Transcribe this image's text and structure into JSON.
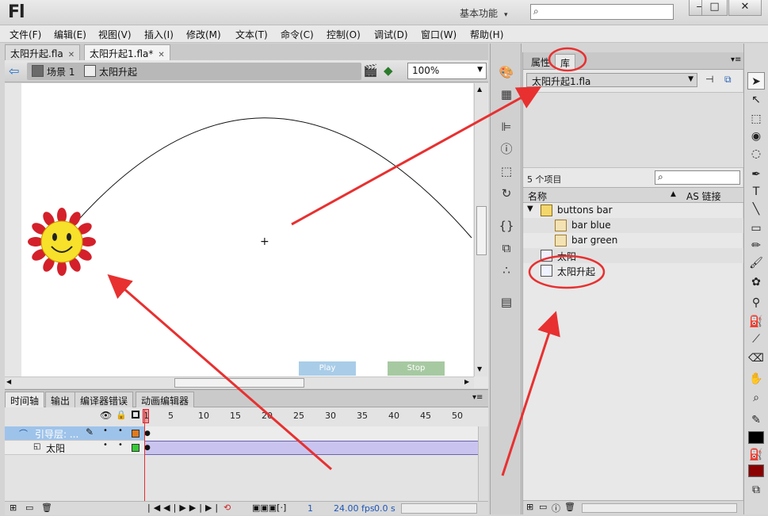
{
  "app": {
    "logo": "Fl",
    "workspace": "基本功能",
    "search_placeholder": ""
  },
  "window_controls": {
    "minimize": "—",
    "maximize": "□",
    "close": "✕"
  },
  "menu": [
    "文件(F)",
    "编辑(E)",
    "视图(V)",
    "插入(I)",
    "修改(M)",
    "文本(T)",
    "命令(C)",
    "控制(O)",
    "调试(D)",
    "窗口(W)",
    "帮助(H)"
  ],
  "doc_tabs": [
    {
      "label": "太阳升起.fla",
      "active": false
    },
    {
      "label": "太阳升起1.fla*",
      "active": true
    }
  ],
  "edit_bar": {
    "scene": "场景 1",
    "symbol": "太阳升起",
    "zoom": "100%"
  },
  "stage": {
    "play_button": "Play",
    "stop_button": "Stop",
    "crosshair": "+"
  },
  "timeline": {
    "tabs": [
      "时间轴",
      "输出",
      "编译器错误",
      "动画编辑器"
    ],
    "frame_numbers": [
      "1",
      "5",
      "10",
      "15",
      "20",
      "25",
      "30",
      "35",
      "40",
      "45",
      "50"
    ],
    "layers": [
      {
        "name": "引导层: ...",
        "type": "guide",
        "color": "#e07a1c",
        "selected": true
      },
      {
        "name": "太阳",
        "type": "normal",
        "color": "#33cc33",
        "selected": false
      }
    ],
    "current_frame": "1",
    "fps": "24.00 fps",
    "time": "0.0 s"
  },
  "library": {
    "tabs": [
      {
        "label": "属性",
        "active": false
      },
      {
        "label": "库",
        "active": true
      }
    ],
    "file": "太阳升起1.fla",
    "item_count": "5 个项目",
    "columns": {
      "name": "名称",
      "linkage": "AS 链接"
    },
    "items": [
      {
        "name": "buttons bar",
        "kind": "folder",
        "indent": 0
      },
      {
        "name": "bar blue",
        "kind": "button",
        "indent": 1
      },
      {
        "name": "bar green",
        "kind": "button",
        "indent": 1
      },
      {
        "name": "太阳",
        "kind": "graphic",
        "indent": 0
      },
      {
        "name": "太阳升起",
        "kind": "movieclip",
        "indent": 0
      }
    ]
  },
  "colors": {
    "annotation": "#e83030",
    "layer_selected": "#9ec3ea",
    "stroke_color": "#000000",
    "fill_color": "#8b0000"
  }
}
